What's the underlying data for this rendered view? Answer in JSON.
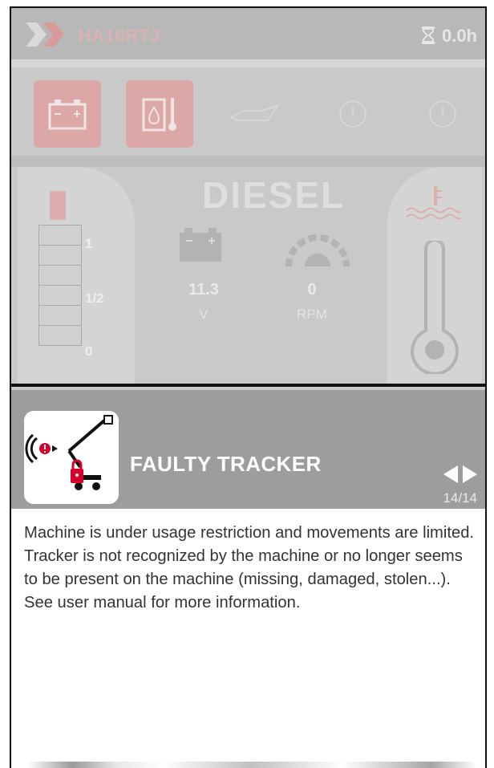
{
  "header": {
    "machine_id": "HA16RTJ",
    "hour_meter": "0.0h"
  },
  "indicators": [
    {
      "name": "battery-warning-icon",
      "active": true
    },
    {
      "name": "hydraulic-oil-temperature-icon",
      "active": true
    },
    {
      "name": "oil-pressure-icon",
      "active": false
    },
    {
      "name": "brake-warning-icon",
      "active": false
    },
    {
      "name": "alert-warning-icon",
      "active": false
    }
  ],
  "fuel": {
    "type": "DIESEL",
    "gauge_labels": {
      "full": "1",
      "half": "1/2",
      "empty": "0"
    }
  },
  "battery": {
    "value": "11.3",
    "unit": "V"
  },
  "engine": {
    "value": "0",
    "unit": "RPM"
  },
  "alert": {
    "title": "FAULTY TRACKER",
    "pager": "14/14",
    "message": "Machine is under usage restriction and movements are limited. Tracker is not recognized by the machine or no longer seems to be present on the machine (missing, damaged, stolen...). See user manual for more information."
  },
  "colors": {
    "accent_red": "#d7002a",
    "dimmed_bg": "#c4c4c4",
    "alert_header": "#9d9d9d"
  }
}
